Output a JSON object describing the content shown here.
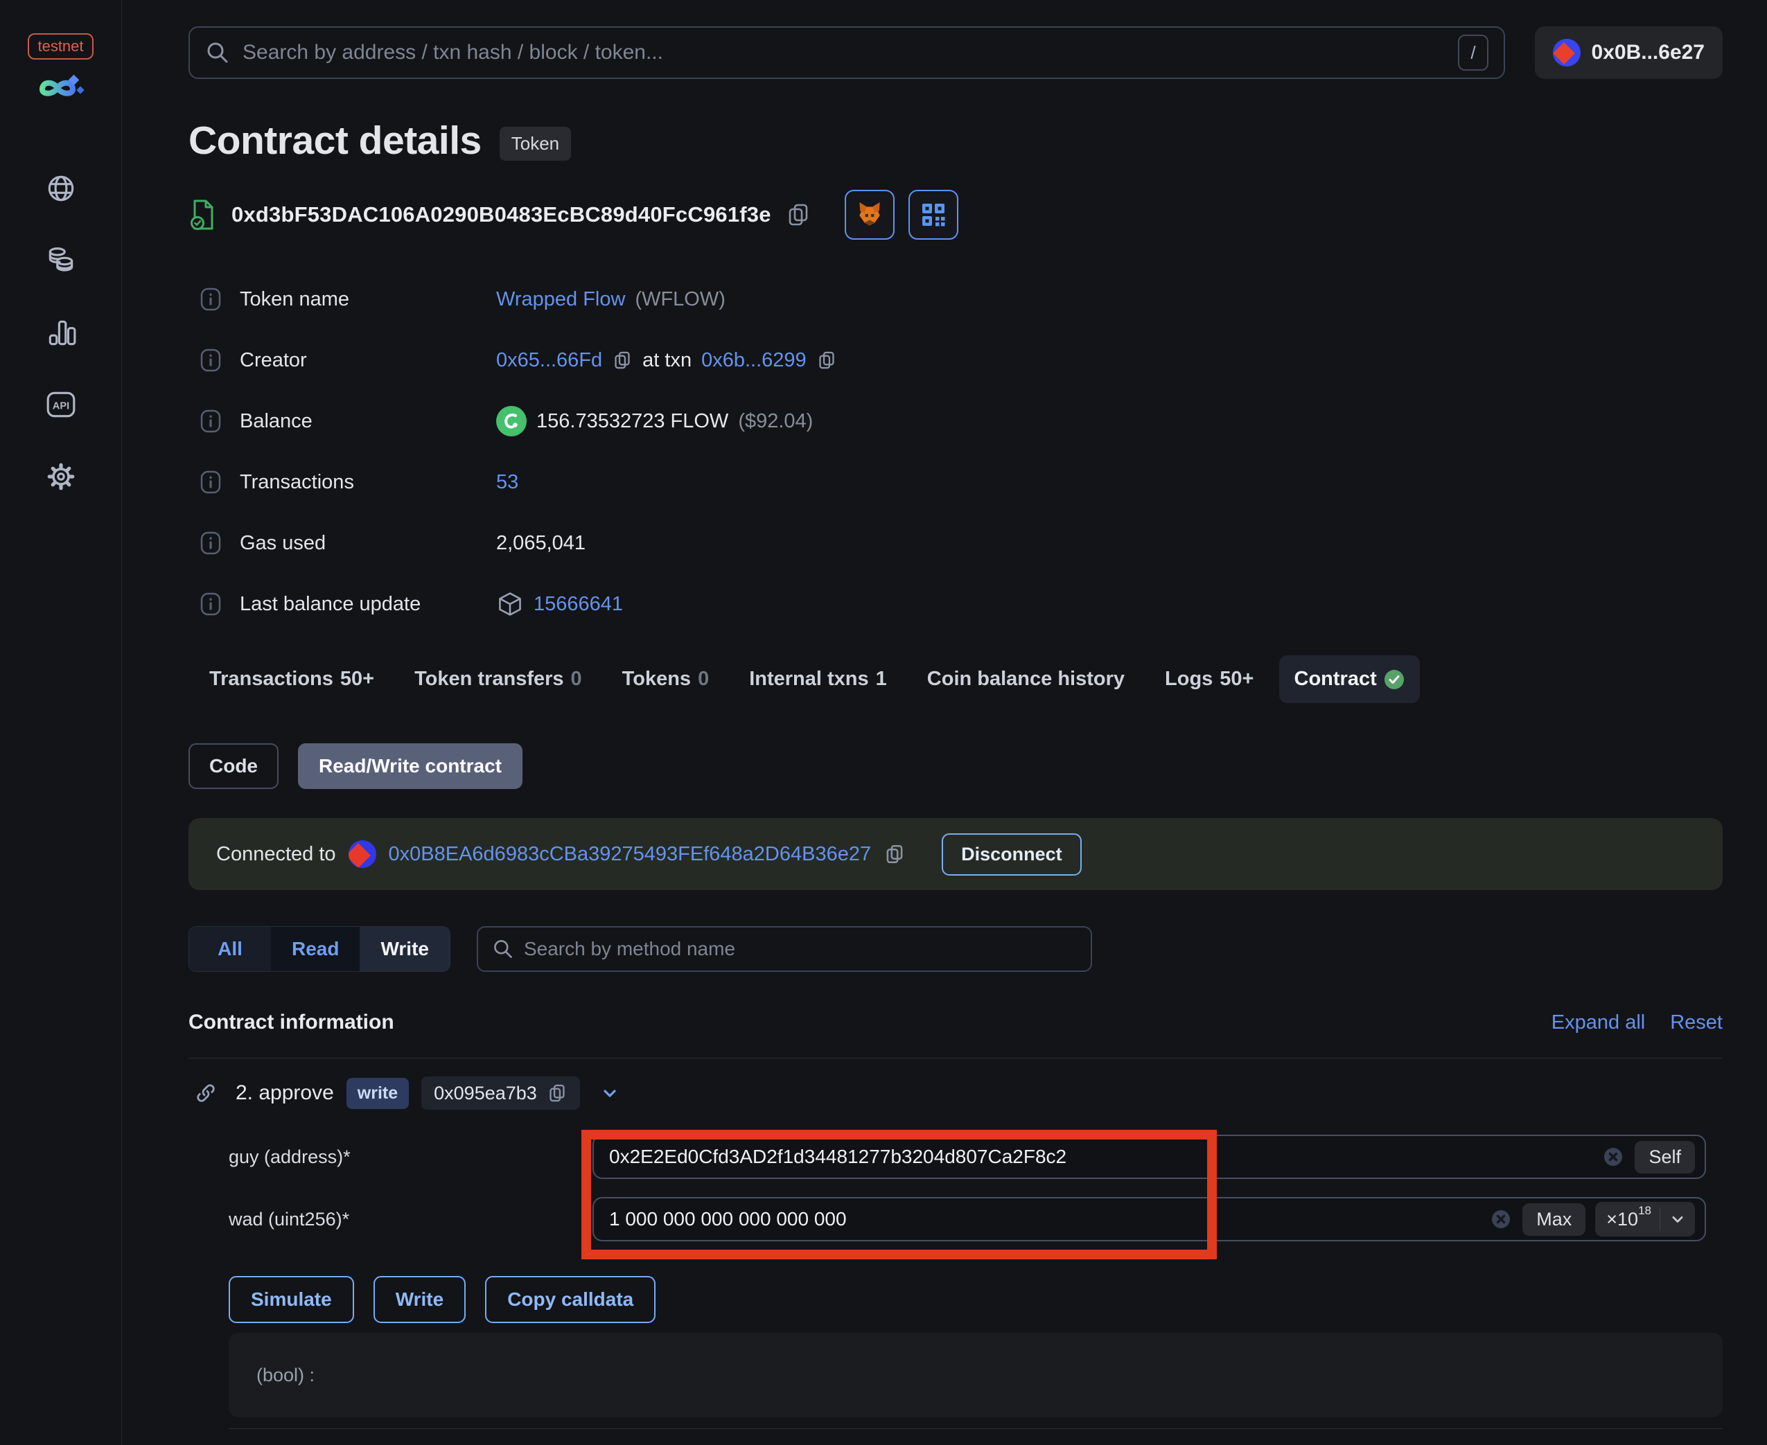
{
  "colors": {
    "accent_blue": "#6493ee",
    "verified_green": "#57a268",
    "flow_green": "#45c06c",
    "annotation_red": "#e23a1d",
    "connected_banner_bg": "#252b24"
  },
  "sidebar": {
    "network_badge": "testnet",
    "icons": [
      "globe",
      "coins",
      "bar-chart",
      "api",
      "gear"
    ]
  },
  "topbar": {
    "search_placeholder": "Search by address / txn hash / block / token...",
    "shortcut_hint": "/",
    "wallet_address": "0x0B...6e27"
  },
  "header": {
    "title": "Contract details",
    "type_badge": "Token",
    "address": "0xd3bF53DAC106A0290B0483EcBC89d40FcC961f3e"
  },
  "info": {
    "token_name": {
      "label": "Token name",
      "link": "Wrapped Flow",
      "symbol": "(WFLOW)"
    },
    "creator": {
      "label": "Creator",
      "address": "0x65...66Fd",
      "at_txn": "at txn",
      "txn": "0x6b...6299"
    },
    "balance": {
      "label": "Balance",
      "amount": "156.73532723 FLOW",
      "usd": "($92.04)"
    },
    "transactions": {
      "label": "Transactions",
      "value": "53"
    },
    "gas_used": {
      "label": "Gas used",
      "value": "2,065,041"
    },
    "last_balance_update": {
      "label": "Last balance update",
      "block": "15666641"
    }
  },
  "tabs": [
    {
      "label": "Transactions",
      "count": "50+"
    },
    {
      "label": "Token transfers",
      "count": "0"
    },
    {
      "label": "Tokens",
      "count": "0"
    },
    {
      "label": "Internal txns",
      "count": "1"
    },
    {
      "label": "Coin balance history",
      "count": ""
    },
    {
      "label": "Logs",
      "count": "50+"
    },
    {
      "label": "Contract",
      "count": ""
    }
  ],
  "contract_tabs": {
    "code": "Code",
    "readwrite": "Read/Write contract"
  },
  "connection": {
    "prefix": "Connected to",
    "address": "0x0B8EA6d6983cCBa39275493FEf648a2D64B36e27",
    "disconnect": "Disconnect"
  },
  "method_filter": {
    "all": "All",
    "read": "Read",
    "write": "Write",
    "search_placeholder": "Search by method name"
  },
  "contract_info": {
    "heading": "Contract information",
    "expand_all": "Expand all",
    "reset": "Reset"
  },
  "method": {
    "name": "2. approve",
    "type_badge": "write",
    "selector": "0x095ea7b3",
    "fields": [
      {
        "label": "guy (address)*",
        "value": "0x2E2Ed0Cfd3AD2f1d34481277b3204d807Ca2F8c2",
        "action": "Self"
      },
      {
        "label": "wad (uint256)*",
        "value": "1 000 000 000 000 000 000",
        "action": "Max",
        "multiplier": "×10",
        "exponent": "18"
      }
    ],
    "buttons": [
      "Simulate",
      "Write",
      "Copy calldata"
    ],
    "output": "(bool) :"
  }
}
